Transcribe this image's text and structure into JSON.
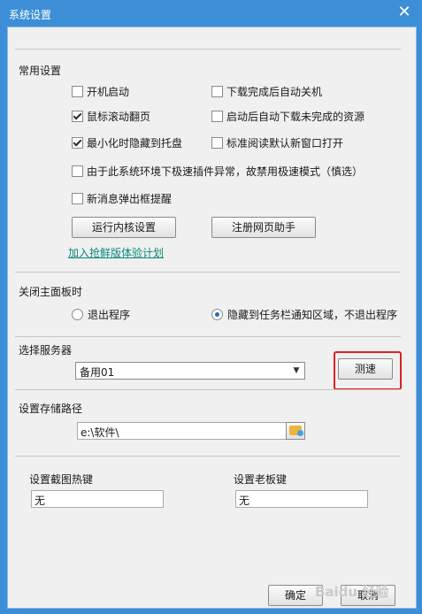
{
  "window": {
    "title": "系统设置",
    "close": "✕"
  },
  "general": {
    "heading": "常用设置",
    "checkboxes": [
      {
        "label": "开机启动",
        "checked": false
      },
      {
        "label": "下载完成后自动关机",
        "checked": false
      },
      {
        "label": "鼠标滚动翻页",
        "checked": true
      },
      {
        "label": "启动后自动下载未完成的资源",
        "checked": false
      },
      {
        "label": "最小化时隐藏到托盘",
        "checked": true
      },
      {
        "label": "标准阅读默认新窗口打开",
        "checked": false
      },
      {
        "label": "由于此系统环境下极速插件异常，故禁用极速模式（慎选）",
        "checked": false
      },
      {
        "label": "新消息弹出框提醒",
        "checked": false
      }
    ],
    "kernel_button": "运行内核设置",
    "register_button": "注册网页助手",
    "beta_link": "加入抢鲜版体验计划"
  },
  "close_panel": {
    "heading": "关闭主面板时",
    "options": [
      {
        "label": "退出程序",
        "selected": false
      },
      {
        "label": "隐藏到任务栏通知区域，不退出程序",
        "selected": true
      }
    ]
  },
  "server": {
    "heading": "选择服务器",
    "selected": "备用01",
    "test_button": "测速"
  },
  "storage": {
    "heading": "设置存储路径",
    "path": "e:\\软件\\"
  },
  "hotkeys": {
    "screenshot_label": "设置截图热键",
    "screenshot_value": "无",
    "boss_label": "设置老板键",
    "boss_value": "无"
  },
  "footer": {
    "ok": "确定",
    "cancel": "取消"
  },
  "watermark": "Baidu 经验"
}
